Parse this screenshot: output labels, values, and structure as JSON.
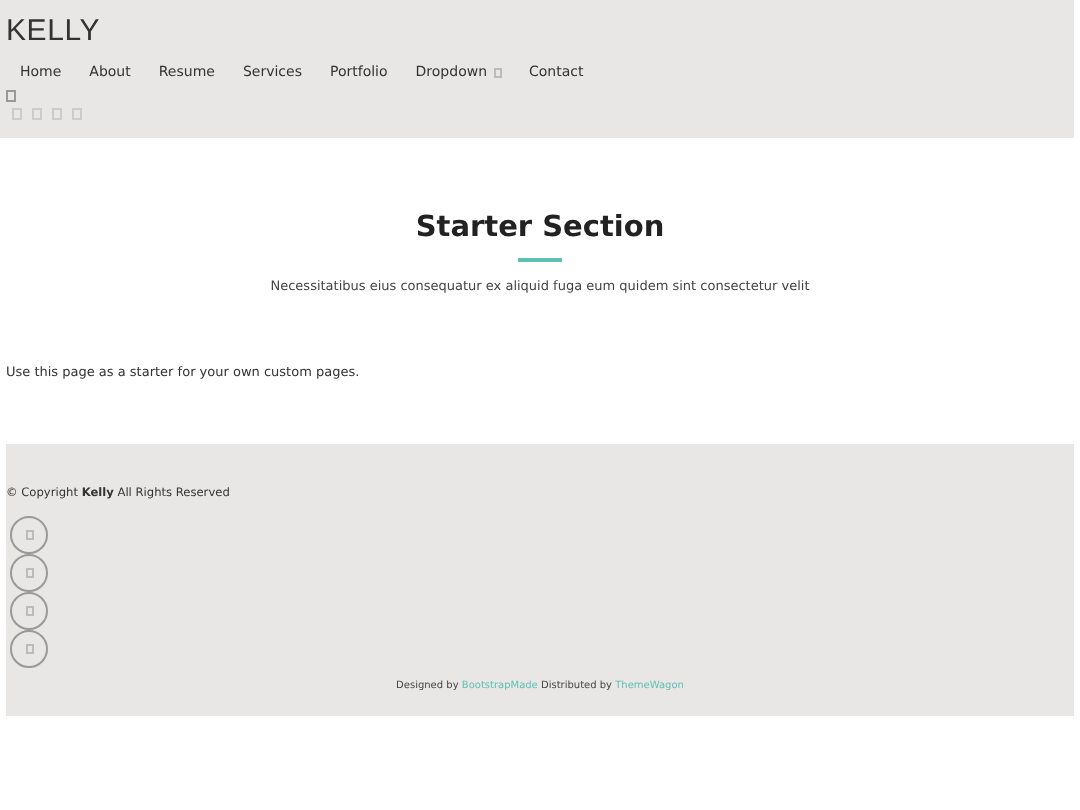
{
  "header": {
    "brand": "KELLY",
    "nav": [
      {
        "label": "Home",
        "dropdown": false
      },
      {
        "label": "About",
        "dropdown": false
      },
      {
        "label": "Resume",
        "dropdown": false
      },
      {
        "label": "Services",
        "dropdown": false
      },
      {
        "label": "Portfolio",
        "dropdown": false
      },
      {
        "label": "Dropdown",
        "dropdown": true
      },
      {
        "label": "Contact",
        "dropdown": false
      }
    ]
  },
  "section": {
    "title": "Starter Section",
    "subtitle": "Necessitatibus eius consequatur ex aliquid fuga eum quidem sint consectetur velit"
  },
  "body_text": "Use this page as a starter for your own custom pages.",
  "footer": {
    "copyright": "© Copyright **Kelly** All Rights Reserved",
    "credits": [
      {
        "text": "Designed by",
        "kind": "text"
      },
      {
        "text": "BootstrapMade",
        "kind": "link"
      },
      {
        "text": "Distributed by",
        "kind": "text"
      },
      {
        "text": "ThemeWagon",
        "kind": "link"
      }
    ]
  }
}
